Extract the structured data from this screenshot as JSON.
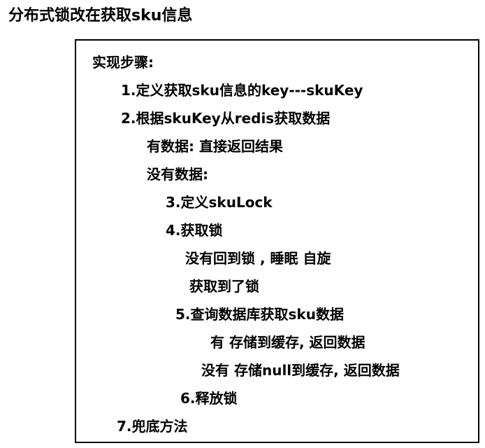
{
  "heading": "分布式锁改在获取sku信息",
  "steps": {
    "title": "实现步骤:",
    "lines": [
      "1.定义获取sku信息的key---skuKey",
      "2.根据skuKey从redis获取数据",
      "有数据: 直接返回结果",
      "没有数据:",
      "3.定义skuLock",
      "4.获取锁",
      "没有回到锁 , 睡眠 自旋",
      "获取到了锁",
      "5.查询数据库获取sku数据",
      "有 存储到缓存, 返回数据",
      "没有 存储null到缓存, 返回数据",
      "6.释放锁",
      "7.兜底方法"
    ]
  }
}
